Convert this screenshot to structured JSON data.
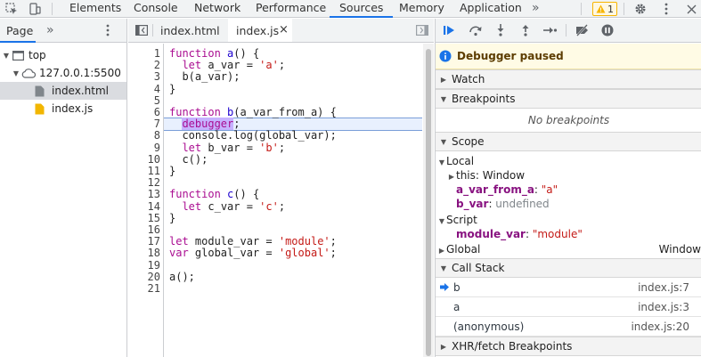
{
  "topbar": {
    "tabs": [
      "Elements",
      "Console",
      "Network",
      "Performance",
      "Sources",
      "Memory",
      "Application"
    ],
    "active_tab": "Sources",
    "more": "»",
    "warning_count": "1"
  },
  "navigator": {
    "tab_label": "Page",
    "more": "»",
    "tree": {
      "top": "top",
      "origin": "127.0.0.1:5500",
      "files": [
        "index.html",
        "index.js"
      ]
    }
  },
  "editor": {
    "tabs": [
      "index.html",
      "index.js"
    ],
    "active_tab": "index.js",
    "close": "×",
    "paused_line": 7,
    "lines": [
      "function a() {",
      "  let a_var = 'a';",
      "  b(a_var);",
      "}",
      "",
      "function b(a_var_from_a) {",
      "  debugger;",
      "  console.log(global_var);",
      "  let b_var = 'b';",
      "  c();",
      "}",
      "",
      "function c() {",
      "  let c_var = 'c';",
      "}",
      "",
      "let module_var = 'module';",
      "var global_var = 'global';",
      "",
      "a();",
      ""
    ]
  },
  "debugger": {
    "paused_message": "Debugger paused",
    "sections": {
      "watch": "Watch",
      "breakpoints": "Breakpoints",
      "scope": "Scope",
      "call_stack": "Call Stack",
      "xhr": "XHR/fetch Breakpoints"
    },
    "no_breakpoints": "No breakpoints",
    "scope": {
      "local_label": "Local",
      "this_name": "this",
      "this_value": "Window",
      "a_var_from_a_name": "a_var_from_a",
      "a_var_from_a_value": "\"a\"",
      "b_var_name": "b_var",
      "b_var_value": "undefined",
      "script_label": "Script",
      "module_var_name": "module_var",
      "module_var_value": "\"module\"",
      "global_label": "Global",
      "global_value": "Window"
    },
    "call_stack": [
      {
        "fn": "b",
        "loc": "index.js:7"
      },
      {
        "fn": "a",
        "loc": "index.js:3"
      },
      {
        "fn": "(anonymous)",
        "loc": "index.js:20"
      }
    ]
  }
}
